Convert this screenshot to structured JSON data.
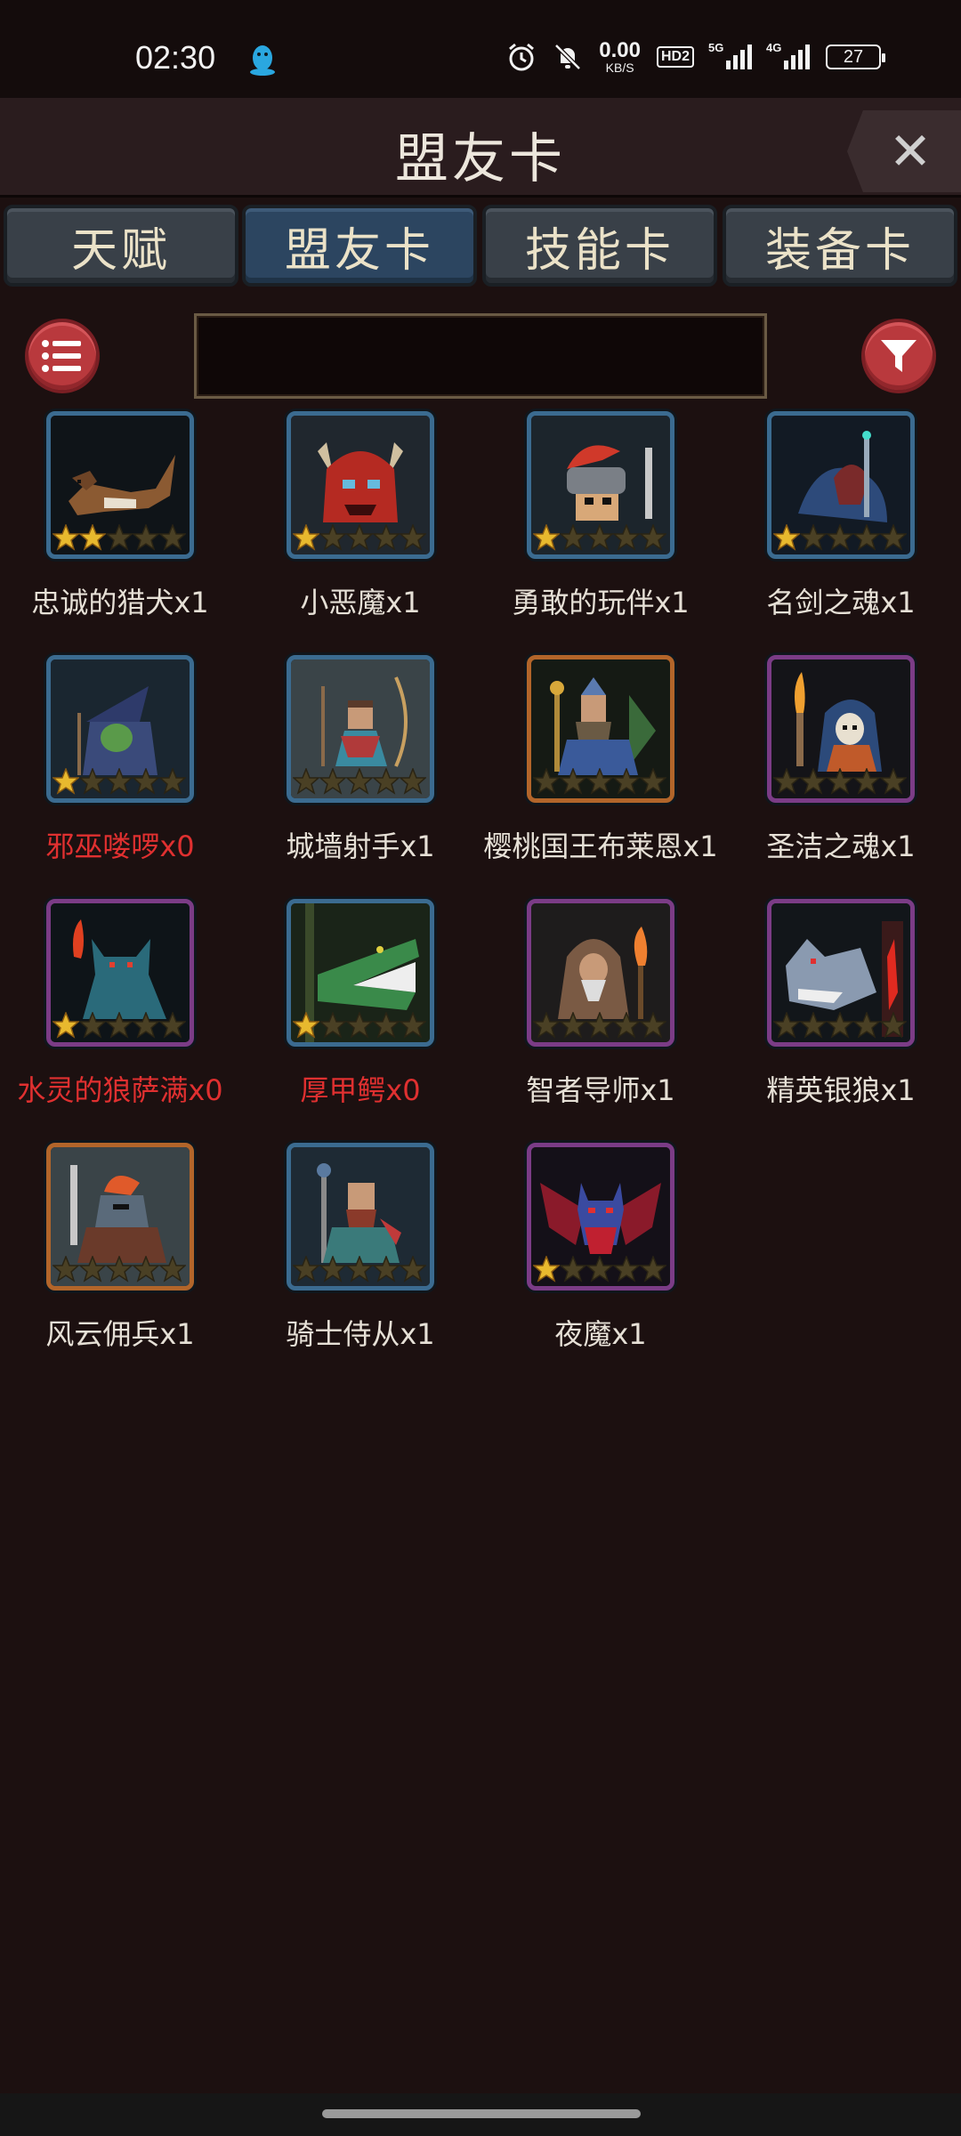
{
  "status_bar": {
    "time": "02:30",
    "net_speed_value": "0.00",
    "net_speed_unit": "KB/S",
    "hd_badge": "HD2",
    "net1_label": "5G",
    "net2_label": "4G",
    "battery": "27",
    "icons": [
      "qq-penguin-icon",
      "alarm-icon",
      "mute-bell-icon",
      "signal-icon",
      "battery-icon"
    ]
  },
  "header": {
    "title": "盟友卡",
    "close_label": "✕"
  },
  "tabs": [
    {
      "label": "天赋",
      "active": false
    },
    {
      "label": "盟友卡",
      "active": true
    },
    {
      "label": "技能卡",
      "active": false
    },
    {
      "label": "装备卡",
      "active": false
    }
  ],
  "search": {
    "value": "",
    "placeholder": ""
  },
  "cards": [
    {
      "label": "忠诚的猎犬x1",
      "stars": 2,
      "frame": "blue",
      "owned": true
    },
    {
      "label": "小恶魔x1",
      "stars": 1,
      "frame": "blue",
      "owned": true
    },
    {
      "label": "勇敢的玩伴x1",
      "stars": 1,
      "frame": "blue",
      "owned": true
    },
    {
      "label": "名剑之魂x1",
      "stars": 1,
      "frame": "blue",
      "owned": true
    },
    {
      "label": "邪巫喽啰x0",
      "stars": 1,
      "frame": "blue",
      "owned": false
    },
    {
      "label": "城墙射手x1",
      "stars": 0,
      "frame": "blue",
      "owned": true
    },
    {
      "label": "樱桃国王布莱恩x1",
      "stars": 0,
      "frame": "orange",
      "owned": true
    },
    {
      "label": "圣洁之魂x1",
      "stars": 0,
      "frame": "purple",
      "owned": true
    },
    {
      "label": "水灵的狼萨满x0",
      "stars": 1,
      "frame": "purple",
      "owned": false
    },
    {
      "label": "厚甲鳄x0",
      "stars": 1,
      "frame": "blue",
      "owned": false
    },
    {
      "label": "智者导师x1",
      "stars": 0,
      "frame": "purple",
      "owned": true
    },
    {
      "label": "精英银狼x1",
      "stars": 0,
      "frame": "purple",
      "owned": true
    },
    {
      "label": "风云佣兵x1",
      "stars": 0,
      "frame": "orange",
      "owned": true
    },
    {
      "label": "骑士侍从x1",
      "stars": 0,
      "frame": "blue",
      "owned": true
    },
    {
      "label": "夜魔x1",
      "stars": 1,
      "frame": "purple",
      "owned": true
    }
  ],
  "colors": {
    "background": "#1c1010",
    "tab_active": "#2c4560",
    "tab": "#394048",
    "button_red": "#b9393d",
    "unowned_text": "#e03030",
    "star_gold": "#e8b92e",
    "star_empty": "#4a4024"
  }
}
